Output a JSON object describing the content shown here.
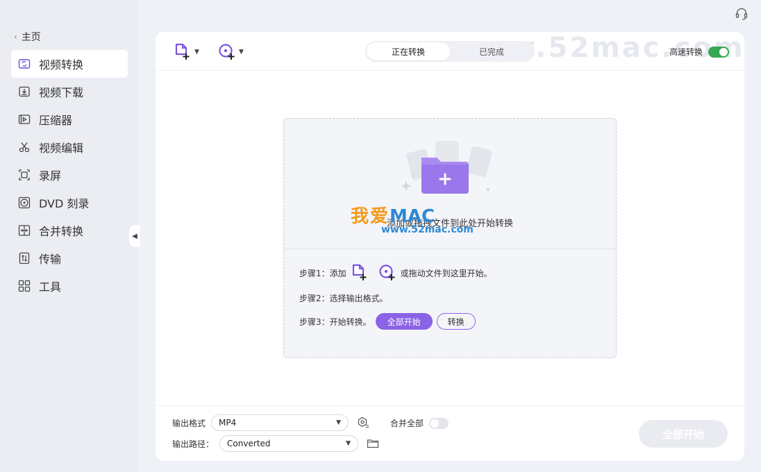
{
  "sidebar": {
    "home_label": "主页",
    "items": [
      {
        "label": "视频转换",
        "icon": "video-convert-icon",
        "active": true
      },
      {
        "label": "视频下载",
        "icon": "video-download-icon"
      },
      {
        "label": "压缩器",
        "icon": "compressor-icon"
      },
      {
        "label": "视频编辑",
        "icon": "scissors-icon"
      },
      {
        "label": "录屏",
        "icon": "screen-record-icon"
      },
      {
        "label": "DVD 刻录",
        "icon": "dvd-icon"
      },
      {
        "label": "合并转换",
        "icon": "merge-icon"
      },
      {
        "label": "传输",
        "icon": "transfer-icon"
      },
      {
        "label": "工具",
        "icon": "tools-icon"
      }
    ]
  },
  "toolbar": {
    "tabs": [
      {
        "label": "正在转换",
        "active": true
      },
      {
        "label": "已完成",
        "active": false
      }
    ],
    "watermark": "www.52mac.com",
    "speed_label": "高速转换",
    "speed_on": true
  },
  "dropzone": {
    "prompt": "添加或拖拽文件到此处开始转换",
    "logo_cn": "我爱",
    "logo_en": "MAC",
    "logo_url": "www.52mac.com",
    "step1_prefix": "步骤1：添加",
    "step1_suffix": "或拖动文件到这里开始。",
    "step2": "步骤2：选择输出格式。",
    "step3": "步骤3：开始转换。",
    "start_all_label": "全部开始",
    "convert_label": "转换"
  },
  "footer": {
    "format_label": "输出格式",
    "format_value": "MP4",
    "path_label": "输出路径：",
    "path_value": "Converted",
    "merge_label": "合并全部",
    "merge_on": false,
    "start_all_label": "全部开始"
  },
  "colors": {
    "accent": "#8a63e6",
    "toggle_on": "#35a853",
    "watermark_orange": "#f39a1b",
    "watermark_blue": "#2d8ad6"
  }
}
